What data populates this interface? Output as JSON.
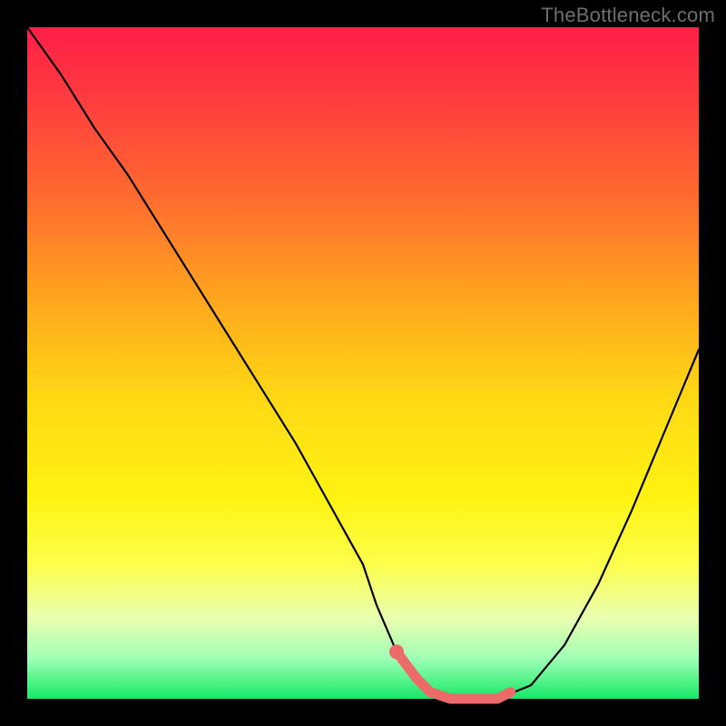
{
  "watermark": "TheBottleneck.com",
  "chart_data": {
    "type": "line",
    "title": "",
    "xlabel": "",
    "ylabel": "",
    "xlim": [
      0,
      100
    ],
    "ylim": [
      0,
      100
    ],
    "grid": false,
    "series": [
      {
        "name": "bottleneck-curve",
        "x": [
          0,
          5,
          10,
          15,
          20,
          25,
          30,
          35,
          40,
          45,
          50,
          52,
          55,
          58,
          60,
          63,
          66,
          70,
          75,
          80,
          85,
          90,
          95,
          100
        ],
        "y": [
          100,
          93,
          85,
          78,
          70,
          62,
          54,
          46,
          38,
          29,
          20,
          14,
          7,
          3,
          1,
          0,
          0,
          0,
          2,
          8,
          17,
          28,
          40,
          52
        ]
      }
    ],
    "highlight": {
      "name": "optimal-range",
      "x": [
        55,
        58,
        60,
        63,
        66,
        70,
        72
      ],
      "y": [
        7,
        3,
        1,
        0,
        0,
        0,
        1
      ]
    },
    "gradient_stops": [
      {
        "pos": 0.0,
        "color": "#ff1f47"
      },
      {
        "pos": 0.25,
        "color": "#ff6a30"
      },
      {
        "pos": 0.55,
        "color": "#ffd814"
      },
      {
        "pos": 0.8,
        "color": "#fcff4c"
      },
      {
        "pos": 1.0,
        "color": "#16e867"
      }
    ]
  }
}
